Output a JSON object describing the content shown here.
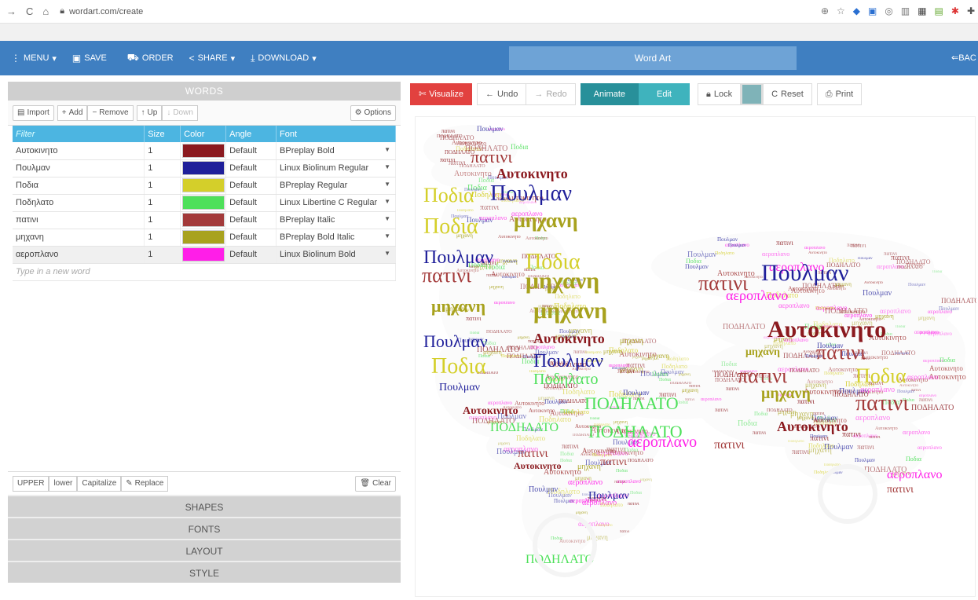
{
  "browser": {
    "url": "wordart.com/create"
  },
  "menubar": {
    "menu": "MENU",
    "save": "SAVE",
    "order": "ORDER",
    "share": "SHARE",
    "download": "DOWNLOAD",
    "title": "Word Art",
    "back": "BAC"
  },
  "words_panel": {
    "title": "WORDS",
    "toolbar": {
      "import": "Import",
      "add": "Add",
      "remove": "Remove",
      "up": "Up",
      "down": "Down",
      "options": "Options"
    },
    "columns": [
      "Filter",
      "Size",
      "Color",
      "Angle",
      "Font"
    ],
    "rows": [
      {
        "word": "Αυτοκινητο",
        "size": "1",
        "color": "#8b1a1f",
        "angle": "Default",
        "font": "BPreplay Bold"
      },
      {
        "word": "Πουλμαν",
        "size": "1",
        "color": "#1f1f9a",
        "angle": "Default",
        "font": "Linux Biolinum Regular"
      },
      {
        "word": "Ποδια",
        "size": "1",
        "color": "#d4cf2a",
        "angle": "Default",
        "font": "BPreplay Regular"
      },
      {
        "word": "Ποδηλατο",
        "size": "1",
        "color": "#4ee05a",
        "angle": "Default",
        "font": "Linux Libertine C Regular"
      },
      {
        "word": "πατινι",
        "size": "1",
        "color": "#a33a3a",
        "angle": "Default",
        "font": "BPreplay Italic"
      },
      {
        "word": "μηχανη",
        "size": "1",
        "color": "#a8a21e",
        "angle": "Default",
        "font": "BPreplay Bold Italic"
      },
      {
        "word": "αεροπλανο",
        "size": "1",
        "color": "#ff1ee8",
        "angle": "Default",
        "font": "Linux Biolinum Bold"
      }
    ],
    "new_word_placeholder": "Type in a new word",
    "bottom": {
      "upper": "UPPER",
      "lower": "lower",
      "capitalize": "Capitalize",
      "replace": "Replace",
      "clear": "Clear"
    }
  },
  "sections": [
    "SHAPES",
    "FONTS",
    "LAYOUT",
    "STYLE"
  ],
  "canvas_toolbar": {
    "visualize": "Visualize",
    "undo": "Undo",
    "redo": "Redo",
    "animate": "Animate",
    "edit": "Edit",
    "lock": "Lock",
    "lock_color": "#7fb3b8",
    "reset": "Reset",
    "print": "Print"
  },
  "art_words": [
    "πατινι",
    "Πουλμαν",
    "Ποδηλατο",
    "Ποδια",
    "Αυτοκινητο",
    "μηχανη",
    "αεροπλανο",
    "ΠΟΔΗΛΑΤΟ"
  ]
}
